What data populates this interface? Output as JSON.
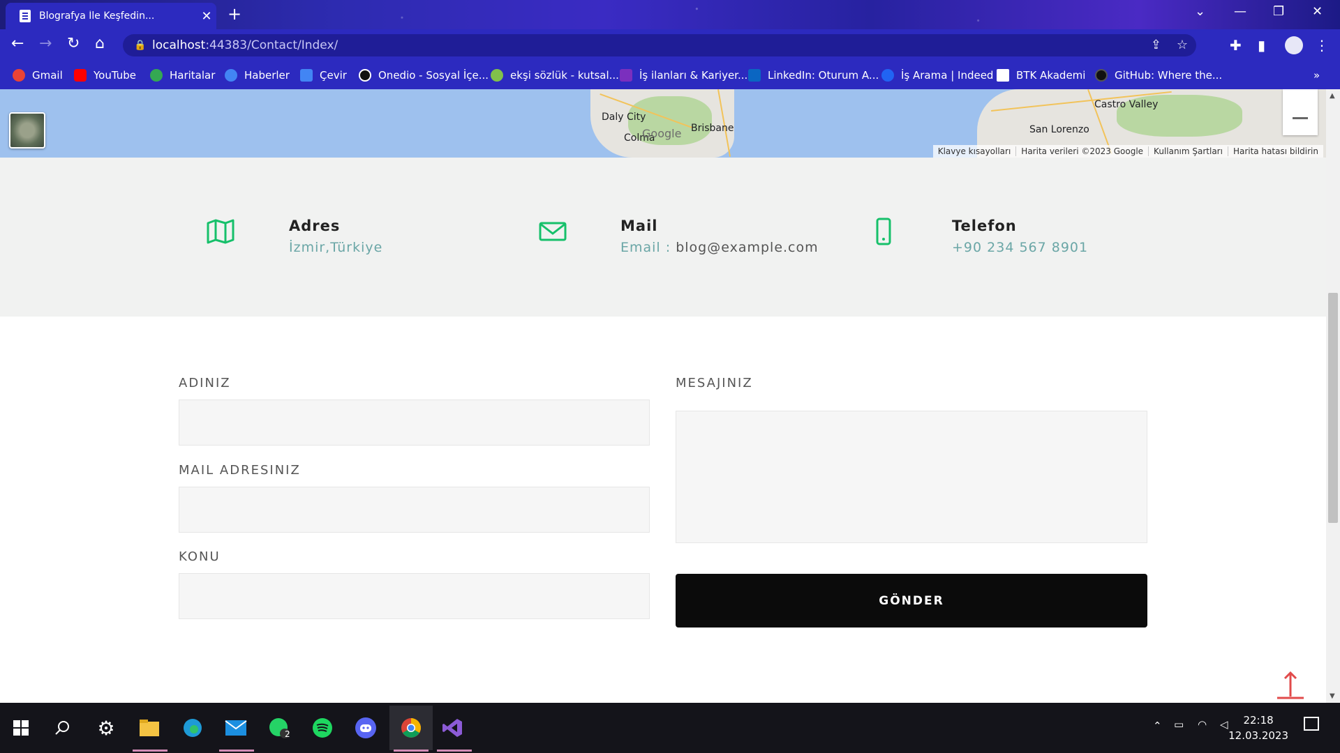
{
  "browser": {
    "tab_title": "Blografya İle Keşfedin...",
    "url_host": "localhost",
    "url_path": ":44383/Contact/Index/"
  },
  "bookmarks": [
    {
      "label": "Gmail",
      "color": "#ea4335"
    },
    {
      "label": "YouTube",
      "color": "#ff0000"
    },
    {
      "label": "Haritalar",
      "color": "#34a853"
    },
    {
      "label": "Haberler",
      "color": "#4285f4"
    },
    {
      "label": "Çevir",
      "color": "#4285f4"
    },
    {
      "label": "Onedio - Sosyal İçe...",
      "color": "#111111"
    },
    {
      "label": "ekşi sözlük - kutsal...",
      "color": "#81c14b"
    },
    {
      "label": "İş ilanları & Kariyer...",
      "color": "#7b2fbe"
    },
    {
      "label": "LinkedIn: Oturum A...",
      "color": "#0a66c2"
    },
    {
      "label": "İş Arama | Indeed",
      "color": "#2164f3"
    },
    {
      "label": "BTK Akademi",
      "color": "#ffffff"
    },
    {
      "label": "GitHub: Where the...",
      "color": "#111111"
    }
  ],
  "map": {
    "labels": [
      "Daly City",
      "Colma",
      "Brisbane",
      "Castro Valley",
      "San Lorenzo"
    ],
    "logo": "Google",
    "footer": [
      "Klavye kısayolları",
      "Harita verileri ©2023 Google",
      "Kullanım Şartları",
      "Harita hatası bildirin"
    ]
  },
  "contact_info": {
    "address": {
      "title": "Adres",
      "text": "İzmir,Türkiye",
      "icon": "map-icon"
    },
    "mail": {
      "title": "Mail",
      "prefix": "Email :",
      "text": "blog@example.com",
      "icon": "envelope-icon"
    },
    "phone": {
      "title": "Telefon",
      "text": "+90 234 567 8901",
      "icon": "mobile-phone-icon"
    }
  },
  "form": {
    "name_label": "ADINIZ",
    "mail_label": "MAIL ADRESINIZ",
    "subject_label": "KONU",
    "message_label": "MESAJINIZ",
    "submit_label": "GÖNDER"
  },
  "accent_color": "#16c06a",
  "taskbar": {
    "whatsapp_badge": "2",
    "time": "22:18",
    "date": "12.03.2023"
  }
}
